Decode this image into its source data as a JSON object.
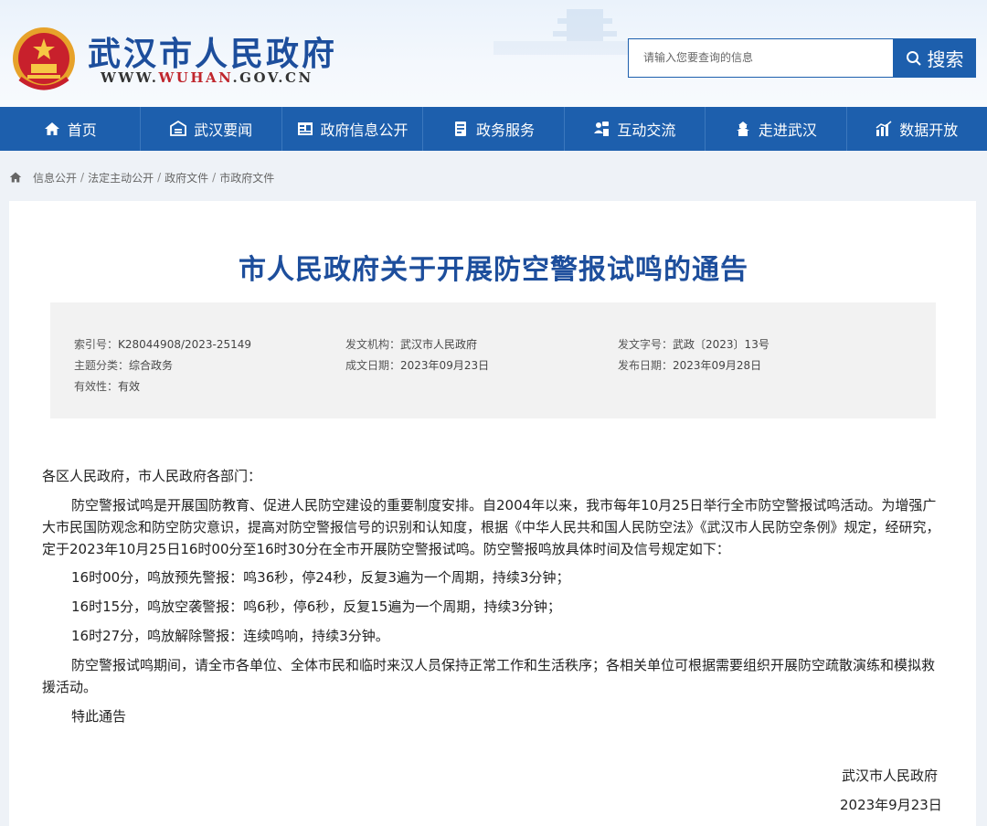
{
  "header": {
    "site_title": "武汉市人民政府",
    "url_prefix": "WWW.",
    "url_highlight": "WUHAN",
    "url_suffix": ".GOV.CN",
    "search_placeholder": "请输入您要查询的信息",
    "search_button": "搜索"
  },
  "nav": {
    "items": [
      {
        "label": "首页",
        "icon": "home-icon"
      },
      {
        "label": "武汉要闻",
        "icon": "news-icon"
      },
      {
        "label": "政府信息公开",
        "icon": "info-disclosure-icon"
      },
      {
        "label": "政务服务",
        "icon": "service-icon"
      },
      {
        "label": "互动交流",
        "icon": "interaction-icon"
      },
      {
        "label": "走进武汉",
        "icon": "city-icon"
      },
      {
        "label": "数据开放",
        "icon": "chart-icon"
      }
    ]
  },
  "breadcrumb": [
    "信息公开",
    "法定主动公开",
    "政府文件",
    "市政府文件"
  ],
  "document": {
    "title": "市人民政府关于开展防空警报试鸣的通告",
    "meta": {
      "index_label": "索引号：",
      "index_value": "K28044908/2023-25149",
      "issuer_label": "发文机构：",
      "issuer_value": "武汉市人民政府",
      "doc_no_label": "发文字号：",
      "doc_no_value": "武政〔2023〕13号",
      "topic_label": "主题分类：",
      "topic_value": "综合政务",
      "created_label": "成文日期：",
      "created_value": "2023年09月23日",
      "published_label": "发布日期：",
      "published_value": "2023年09月28日",
      "validity_label": "有效性：",
      "validity_value": "有效"
    },
    "salutation": "各区人民政府，市人民政府各部门：",
    "para1": "防空警报试鸣是开展国防教育、促进人民防空建设的重要制度安排。自2004年以来，我市每年10月25日举行全市防空警报试鸣活动。为增强广大市民国防观念和防空防灾意识，提高对防空警报信号的识别和认知度，根据《中华人民共和国人民防空法》《武汉市人民防空条例》规定，经研究，定于2023年10月25日16时00分至16时30分在全市开展防空警报试鸣。防空警报鸣放具体时间及信号规定如下：",
    "item1": "16时00分，鸣放预先警报：鸣36秒，停24秒，反复3遍为一个周期，持续3分钟；",
    "item2": "16时15分，鸣放空袭警报：鸣6秒，停6秒，反复15遍为一个周期，持续3分钟；",
    "item3": "16时27分，鸣放解除警报：连续鸣响，持续3分钟。",
    "para2": "防空警报试鸣期间，请全市各单位、全体市民和临时来汉人员保持正常工作和生活秩序；各相关单位可根据需要组织开展防空疏散演练和模拟救援活动。",
    "closing": "特此通告",
    "signer": "武汉市人民政府",
    "date": "2023年9月23日"
  },
  "colors": {
    "brand_blue": "#1d5fad",
    "title_blue": "#1d4e9c",
    "url_red": "#c0262d",
    "meta_bg": "#f2f2f2"
  }
}
